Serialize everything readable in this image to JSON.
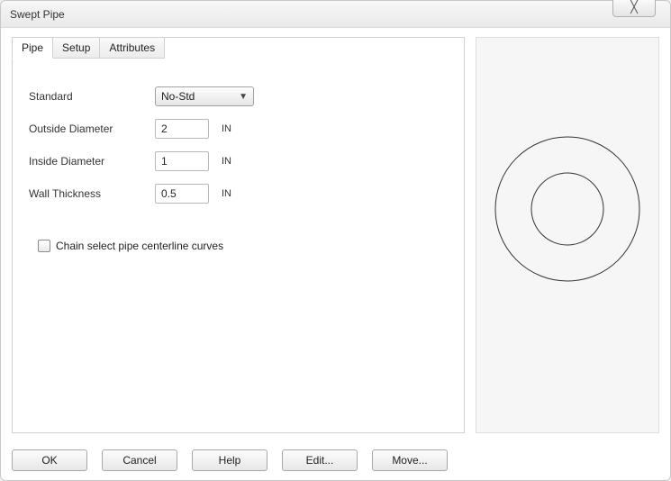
{
  "window": {
    "title": "Swept Pipe"
  },
  "tabs": {
    "pipe": {
      "label": "Pipe"
    },
    "setup": {
      "label": "Setup"
    },
    "attributes": {
      "label": "Attributes"
    }
  },
  "form": {
    "standard": {
      "label": "Standard",
      "value": "No-Std"
    },
    "outside_diameter": {
      "label": "Outside Diameter",
      "value": "2",
      "unit": "IN"
    },
    "inside_diameter": {
      "label": "Inside Diameter",
      "value": "1",
      "unit": "IN"
    },
    "wall_thickness": {
      "label": "Wall Thickness",
      "value": "0.5",
      "unit": "IN"
    },
    "chain_select": {
      "label": "Chain select pipe centerline curves",
      "checked": false
    }
  },
  "buttons": {
    "ok": "OK",
    "cancel": "Cancel",
    "help": "Help",
    "edit": "Edit...",
    "move": "Move..."
  },
  "chart_data": {
    "type": "pipe-cross-section",
    "outer_diameter": 2,
    "inner_diameter": 1
  }
}
